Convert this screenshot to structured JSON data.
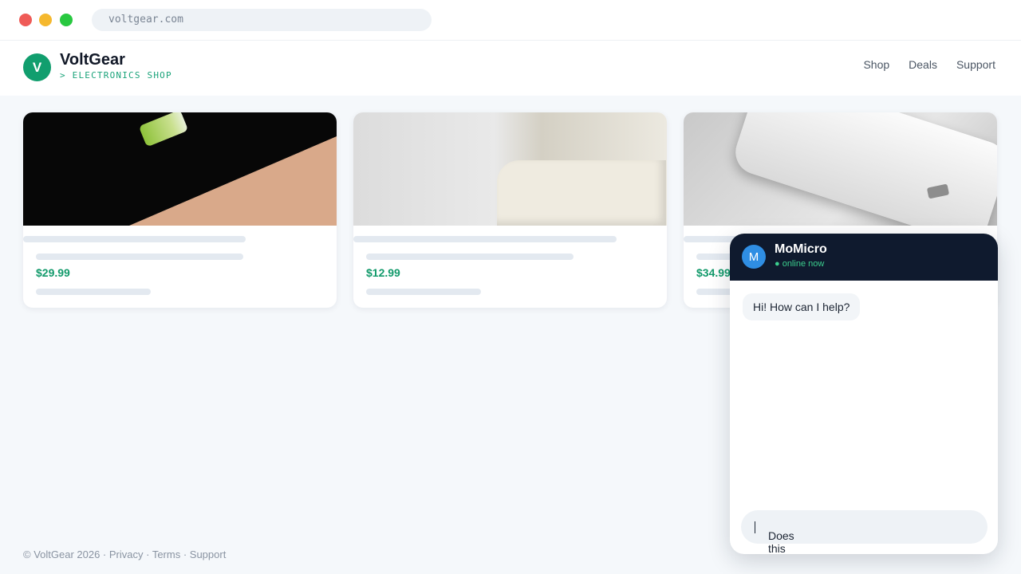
{
  "browser": {
    "url": "voltgear.com"
  },
  "header": {
    "logo_letter": "V",
    "brand": "VoltGear",
    "tagline": "> ELECTRONICS SHOP",
    "nav": [
      "Shop",
      "Deals",
      "Support"
    ]
  },
  "products": [
    {
      "price": "$29.99"
    },
    {
      "price": "$12.99"
    },
    {
      "price": "$34.99"
    }
  ],
  "chat": {
    "avatar_letter": "M",
    "name": "MoMicro",
    "status": "● online now",
    "messages": [
      "Hi! How can I help?"
    ],
    "input_value": "Does this cha"
  },
  "footer": {
    "copyright": "© VoltGear 2026",
    "links": [
      "Privacy",
      "Terms",
      "Support"
    ]
  }
}
